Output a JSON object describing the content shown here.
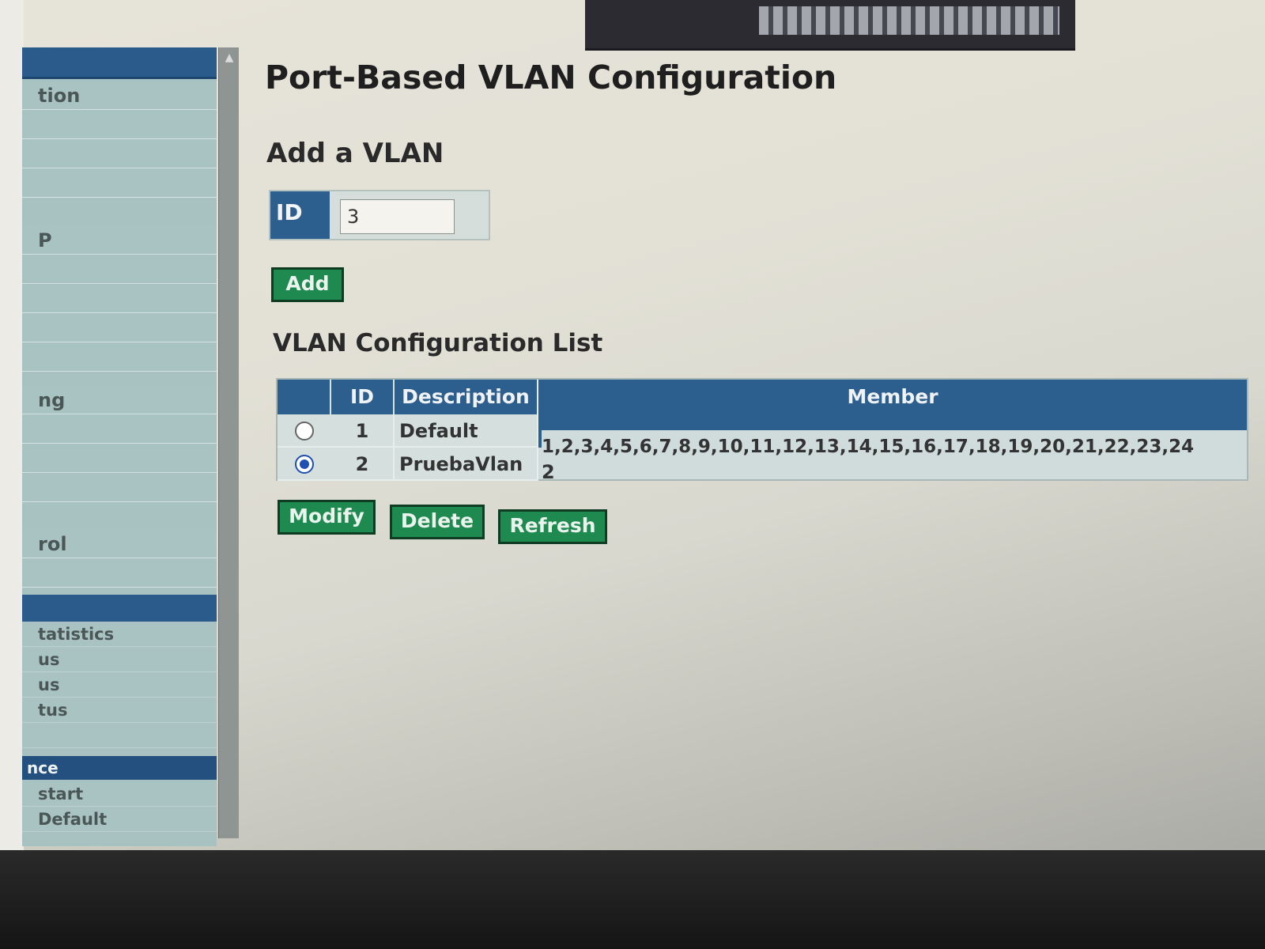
{
  "sidebar": {
    "items": [
      {
        "label": "tion"
      },
      {
        "label": ""
      },
      {
        "label": ""
      },
      {
        "label": ""
      },
      {
        "label": "P"
      },
      {
        "label": ""
      },
      {
        "label": ""
      },
      {
        "label": ""
      },
      {
        "label": ""
      },
      {
        "label": "ng"
      },
      {
        "label": ""
      },
      {
        "label": ""
      },
      {
        "label": ""
      },
      {
        "label": "rol"
      },
      {
        "label": ""
      }
    ],
    "stats_items": [
      "tatistics",
      "us",
      "us",
      "tus"
    ],
    "section2_header": "nce",
    "section2_items": [
      "start",
      "Default"
    ]
  },
  "page": {
    "title": "Port-Based VLAN Configuration",
    "add_section_title": "Add a VLAN",
    "id_label": "ID",
    "id_value": "3",
    "add_button": "Add",
    "list_title": "VLAN Configuration List"
  },
  "table": {
    "headers": {
      "id": "ID",
      "description": "Description",
      "member": "Member"
    },
    "rows": [
      {
        "selected": false,
        "id": "1",
        "description": "Default",
        "member": "1,2,3,4,5,6,7,8,9,10,11,12,13,14,15,16,17,18,19,20,21,22,23,24"
      },
      {
        "selected": true,
        "id": "2",
        "description": "PruebaVlan",
        "member": "2"
      }
    ]
  },
  "actions": {
    "modify": "Modify",
    "delete": "Delete",
    "refresh": "Refresh"
  },
  "colors": {
    "header_blue": "#2c5f8e",
    "button_green": "#1f8a4f",
    "sidebar_teal": "#a8c2c2"
  }
}
